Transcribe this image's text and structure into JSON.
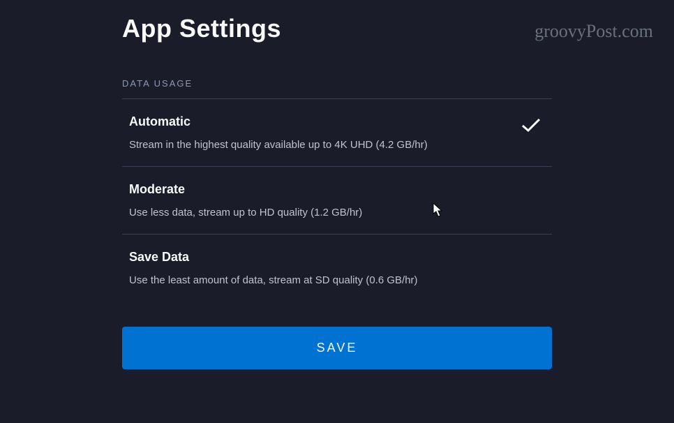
{
  "page": {
    "title": "App Settings"
  },
  "watermark": "groovyPost.com",
  "section": {
    "label": "DATA USAGE"
  },
  "options": [
    {
      "title": "Automatic",
      "description": "Stream in the highest quality available up to 4K UHD (4.2 GB/hr)",
      "selected": true
    },
    {
      "title": "Moderate",
      "description": "Use less data, stream up to HD quality (1.2 GB/hr)",
      "selected": false
    },
    {
      "title": "Save Data",
      "description": "Use the least amount of data, stream at SD quality (0.6 GB/hr)",
      "selected": false
    }
  ],
  "buttons": {
    "save": "SAVE"
  }
}
